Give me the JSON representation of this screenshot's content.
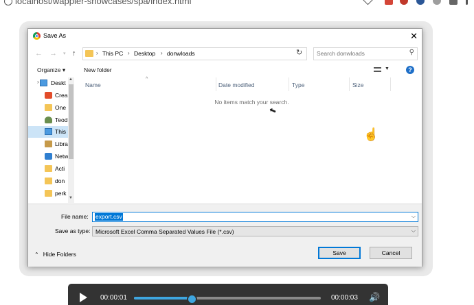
{
  "browser": {
    "url": "localhost/wappier-showcases/spa/index.html"
  },
  "dialog": {
    "title": "Save As",
    "close_symbol": "✕",
    "address": {
      "crumbs": [
        "This PC",
        "Desktop",
        "donwloads"
      ],
      "separator": "›"
    },
    "search": {
      "placeholder": "Search donwloads"
    },
    "toolbar": {
      "organize": "Organize ▾",
      "new_folder": "New folder",
      "help": "?"
    },
    "nav_items": [
      {
        "label": "Deskt",
        "icon": "desktop-icon"
      },
      {
        "label": "Crea",
        "icon": "creative-cloud-icon"
      },
      {
        "label": "One",
        "icon": "folder-icon"
      },
      {
        "label": "Teod",
        "icon": "user-icon"
      },
      {
        "label": "This",
        "icon": "this-pc-icon"
      },
      {
        "label": "Libra",
        "icon": "libraries-icon"
      },
      {
        "label": "Netw",
        "icon": "network-icon"
      },
      {
        "label": "Acti",
        "icon": "folder-icon"
      },
      {
        "label": "don",
        "icon": "folder-icon"
      },
      {
        "label": "perk",
        "icon": "folder-icon"
      }
    ],
    "columns": {
      "name": "Name",
      "date_modified": "Date modified",
      "type": "Type",
      "size": "Size"
    },
    "empty_message": "No items match your search.",
    "file_name_label": "File name:",
    "file_name_value": "export.csv",
    "save_as_type_label": "Save as type:",
    "save_as_type_value": "Microsoft Excel Comma Separated Values File (*.csv)",
    "hide_folders": "Hide Folders",
    "save_button": "Save",
    "cancel_button": "Cancel"
  },
  "video": {
    "current_time": "00:00:01",
    "duration": "00:00:03",
    "progress_fraction": 0.3
  },
  "colors": {
    "accent": "#0078d7",
    "video_bg": "#333333",
    "video_progress": "#3ea6e0"
  }
}
